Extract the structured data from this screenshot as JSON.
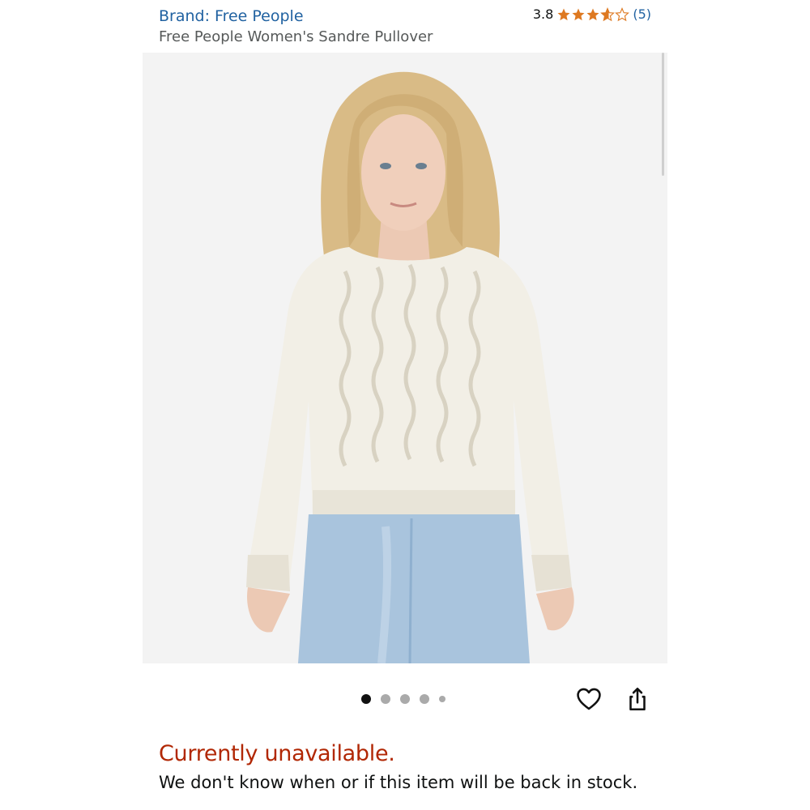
{
  "header": {
    "brand_label": "Brand: Free People",
    "rating_value": "3.8",
    "rating_stars": 3.8,
    "review_count": "(5)",
    "product_title": "Free People Women's Sandre Pullover"
  },
  "gallery": {
    "image_count": 5,
    "active_index": 0,
    "image_subject": "model wearing cream cable-knit pullover with light-wash jeans"
  },
  "actions": {
    "wishlist_icon": "heart-icon",
    "share_icon": "share-icon"
  },
  "availability": {
    "status": "Currently unavailable.",
    "note": "We don't know when or if this item will be back in stock."
  },
  "colors": {
    "link": "#2162a1",
    "star": "#de7921",
    "unavailable": "#b12704",
    "text": "#0f1111",
    "subtext": "#565959"
  }
}
